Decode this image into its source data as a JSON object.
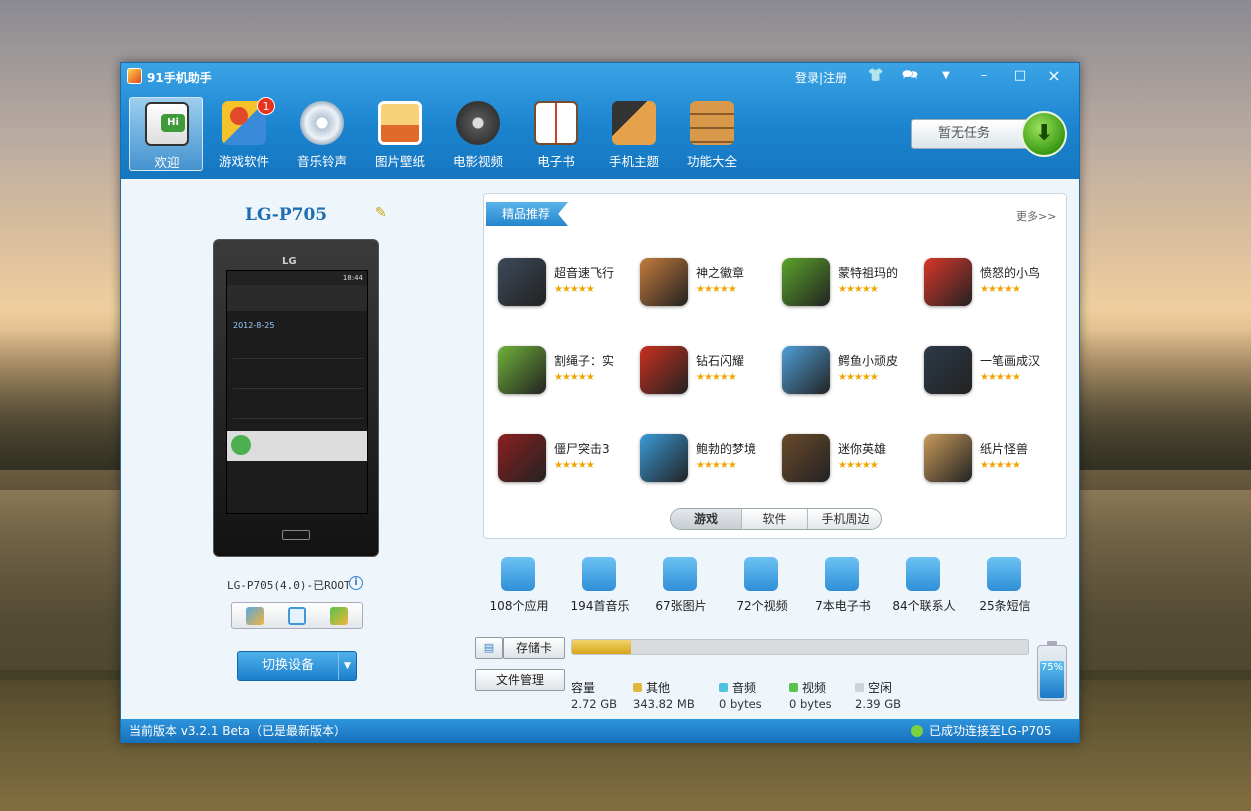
{
  "window": {
    "title": "91手机助手"
  },
  "titlebar": {
    "login": "登录",
    "sep": "|",
    "register": "注册",
    "skin_icon": "shirt-icon",
    "feedback_icon": "chat-icon",
    "menu_icon": "dropdown-icon",
    "minimize": "–",
    "maximize": "□",
    "close": "×"
  },
  "nav": {
    "items": [
      {
        "label": "欢迎",
        "icon": "phone-hi-icon",
        "color": "#3f9b3a"
      },
      {
        "label": "游戏软件",
        "icon": "joystick-icon",
        "color": "#e04a2a",
        "badge": "1"
      },
      {
        "label": "音乐铃声",
        "icon": "cd-music-icon",
        "color": "#b7c6d6"
      },
      {
        "label": "图片壁纸",
        "icon": "picture-icon",
        "color": "#e79a3a"
      },
      {
        "label": "电影视频",
        "icon": "film-reel-icon",
        "color": "#555555"
      },
      {
        "label": "电子书",
        "icon": "book-icon",
        "color": "#c9442f"
      },
      {
        "label": "手机主题",
        "icon": "palette-phone-icon",
        "color": "#e5a24a"
      },
      {
        "label": "功能大全",
        "icon": "cabinet-icon",
        "color": "#c98a3a"
      }
    ]
  },
  "task": {
    "label": "暂无任务"
  },
  "device": {
    "name": "LG-P705",
    "model_line": "LG-P705(4.0)-已ROOT",
    "phone_brand": "LG",
    "screen_clock": "18:44",
    "screen_date": "2012-8-25",
    "switch_label": "切换设备",
    "info": "i"
  },
  "recommend": {
    "title": "精品推荐",
    "more": "更多>>",
    "apps": [
      {
        "name": "超音速飞行",
        "stars": "★★★★★",
        "color": "#3d4a5a"
      },
      {
        "name": "神之徽章",
        "stars": "★★★★★",
        "color": "#c47b3b"
      },
      {
        "name": "蒙特祖玛的",
        "stars": "★★★★★",
        "color": "#5ba42a"
      },
      {
        "name": "愤怒的小鸟",
        "stars": "★★★★★",
        "color": "#d8372a"
      },
      {
        "name": "割绳子：实",
        "stars": "★★★★★",
        "color": "#6fb23a"
      },
      {
        "name": "钻石闪耀",
        "stars": "★★★★★",
        "color": "#c8301f"
      },
      {
        "name": "鳄鱼小顽皮",
        "stars": "★★★★★",
        "color": "#4f9fd8"
      },
      {
        "name": "一笔画成汉",
        "stars": "★★★★★",
        "color": "#2d3a48"
      },
      {
        "name": "僵尸突击3",
        "stars": "★★★★★",
        "color": "#8c1f1f"
      },
      {
        "name": "鲍勃的梦境",
        "stars": "★★★★★",
        "color": "#3a9ad8"
      },
      {
        "name": "迷你英雄",
        "stars": "★★★★★",
        "color": "#6b4a2a"
      },
      {
        "name": "纸片怪兽",
        "stars": "★★★★★",
        "color": "#c89a5a"
      }
    ],
    "tabs": [
      "游戏",
      "软件",
      "手机周边"
    ]
  },
  "stats": [
    {
      "label": "108个应用",
      "icon": "gamepad-icon",
      "color": "#2f8fd8"
    },
    {
      "label": "194首音乐",
      "icon": "disc-icon",
      "color": "#2f8fd8"
    },
    {
      "label": "67张图片",
      "icon": "photo-icon",
      "color": "#2f8fd8"
    },
    {
      "label": "72个视频",
      "icon": "clapper-icon",
      "color": "#2f8fd8"
    },
    {
      "label": "7本电子书",
      "icon": "ebook-icon",
      "color": "#2f8fd8"
    },
    {
      "label": "84个联系人",
      "icon": "contact-icon",
      "color": "#2f8fd8"
    },
    {
      "label": "25条短信",
      "icon": "sms-icon",
      "color": "#2f8fd8"
    }
  ],
  "storage": {
    "sd_label": "存储卡",
    "file_mgr": "文件管理",
    "used_fraction": 0.13,
    "legend": [
      {
        "name": "容量",
        "value": "2.72 GB",
        "color": ""
      },
      {
        "name": "其他",
        "value": "343.82 MB",
        "color": "#e0b93a"
      },
      {
        "name": "音频",
        "value": "0 bytes",
        "color": "#4fc3e0"
      },
      {
        "name": "视频",
        "value": "0 bytes",
        "color": "#5ac24a"
      },
      {
        "name": "空闲",
        "value": "2.39 GB",
        "color": "#cfd3d6"
      }
    ],
    "battery": "75%",
    "battery_level": 0.75
  },
  "status": {
    "version": "当前版本 v3.2.1 Beta（已是最新版本）",
    "connected": "已成功连接至LG-P705"
  }
}
